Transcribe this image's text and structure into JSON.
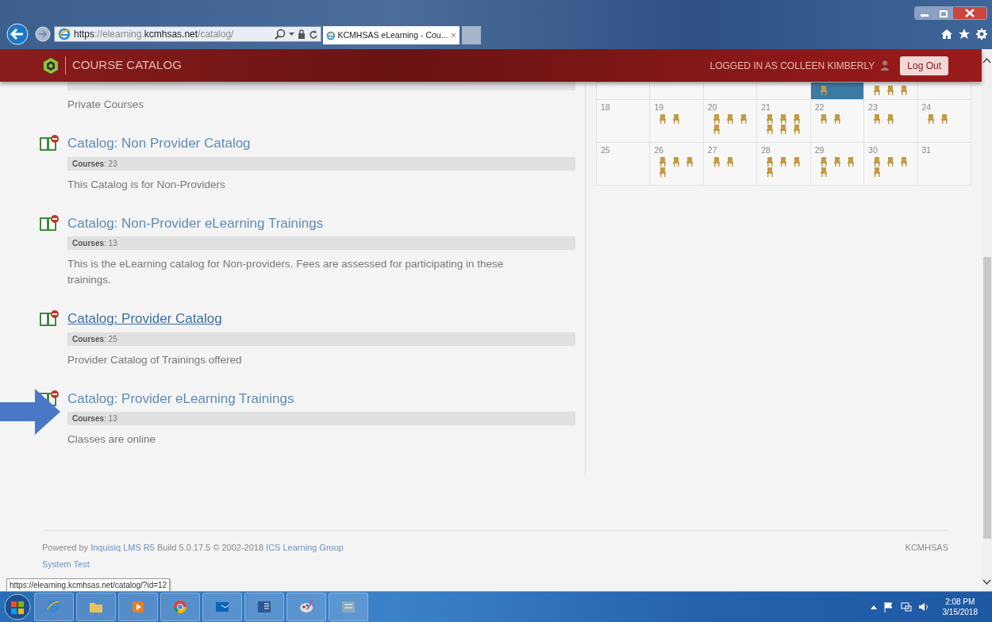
{
  "browser": {
    "address": "**https**://elearning.**kcmhsas.net**/catalog/",
    "tab": {
      "title": "KCMHSAS eLearning - Cou...",
      "close": "×"
    }
  },
  "header": {
    "title": "COURSE CATALOG",
    "user_label": "LOGGED IN AS COLLEEN KIMBERLY",
    "logout": "Log Out"
  },
  "partial_catalog": {
    "description": "Private Courses"
  },
  "catalogs": [
    {
      "title": "Catalog: Non Provider Catalog",
      "courses": "**Courses**: 23",
      "description": "This Catalog is for Non-Providers",
      "hovered": false
    },
    {
      "title": "Catalog: Non-Provider eLearning Trainings",
      "courses": "**Courses**: 13",
      "description": "This is the eLearning catalog for Non-providers. Fees are assessed for participating in these trainings.",
      "hovered": false
    },
    {
      "title": "Catalog: Provider Catalog",
      "courses": "**Courses**: 25",
      "description": "Provider Catalog of Trainings offered",
      "hovered": true
    },
    {
      "title": "Catalog: Provider eLearning Trainings",
      "courses": "**Courses**: 13",
      "description": "Classes are online",
      "hovered": false
    }
  ],
  "calendar": {
    "weeks": [
      {
        "days": [
          {
            "selected": false
          },
          {
            "selected": false
          },
          {
            "selected": false
          },
          {
            "selected": false
          },
          {
            "events": [
              {
                "kind": "seat"
              }
            ],
            "selected": true
          },
          {
            "events": [
              {
                "kind": "seat"
              },
              {
                "kind": "seat"
              },
              {
                "kind": "seat"
              }
            ],
            "selected": false
          },
          {
            "selected": false
          }
        ]
      },
      {
        "days": [
          {
            "day": "18",
            "selected": false
          },
          {
            "day": "19",
            "events": [
              {
                "kind": "seat"
              },
              {
                "kind": "seat"
              }
            ],
            "selected": false
          },
          {
            "day": "20",
            "events": [
              {
                "kind": "seat"
              },
              {
                "kind": "seat"
              },
              {
                "kind": "seat"
              },
              {
                "kind": "seat"
              }
            ],
            "selected": false
          },
          {
            "day": "21",
            "events": [
              {
                "kind": "seat"
              },
              {
                "kind": "seat"
              },
              {
                "kind": "seat"
              },
              {
                "kind": "seat"
              },
              {
                "kind": "seat"
              },
              {
                "kind": "seat"
              }
            ],
            "selected": false
          },
          {
            "day": "22",
            "events": [
              {
                "kind": "seat"
              },
              {
                "kind": "seat"
              }
            ],
            "selected": false
          },
          {
            "day": "23",
            "events": [
              {
                "kind": "seat"
              },
              {
                "kind": "seat"
              }
            ],
            "selected": false
          },
          {
            "day": "24",
            "events": [
              {
                "kind": "seat"
              },
              {
                "kind": "seat"
              }
            ],
            "selected": false
          }
        ]
      },
      {
        "days": [
          {
            "day": "25",
            "selected": false
          },
          {
            "day": "26",
            "events": [
              {
                "kind": "seat"
              },
              {
                "kind": "seat"
              },
              {
                "kind": "seat"
              },
              {
                "kind": "seat"
              }
            ],
            "selected": false
          },
          {
            "day": "27",
            "events": [
              {
                "kind": "seat"
              },
              {
                "kind": "seat"
              }
            ],
            "selected": false
          },
          {
            "day": "28",
            "events": [
              {
                "kind": "seat"
              },
              {
                "kind": "seat"
              },
              {
                "kind": "seat"
              },
              {
                "kind": "seat"
              }
            ],
            "selected": false
          },
          {
            "day": "29",
            "events": [
              {
                "kind": "seat"
              },
              {
                "kind": "seat"
              },
              {
                "kind": "seat"
              },
              {
                "kind": "seat"
              }
            ],
            "selected": false
          },
          {
            "day": "30",
            "events": [
              {
                "kind": "seat"
              },
              {
                "kind": "seat"
              },
              {
                "kind": "seat"
              },
              {
                "kind": "seat"
              }
            ],
            "selected": false
          },
          {
            "day": "31",
            "selected": false
          }
        ]
      }
    ]
  },
  "footer": {
    "credit": [
      {
        "kind": "plain",
        "text": "Powered by"
      },
      {
        "kind": "link",
        "text": "Inquisiq LMS R5"
      },
      {
        "kind": "plain",
        "text": "Build 5.0.17.5  © 2002-2018"
      },
      {
        "kind": "link",
        "text": "ICS Learning Group"
      }
    ],
    "link": "System Test",
    "org": "KCMHSAS"
  },
  "status_tooltip": "https://elearning.kcmhsas.net/catalog/?id=12",
  "taskbar": {
    "time": "2:08 PM",
    "date": "3/15/2018"
  }
}
